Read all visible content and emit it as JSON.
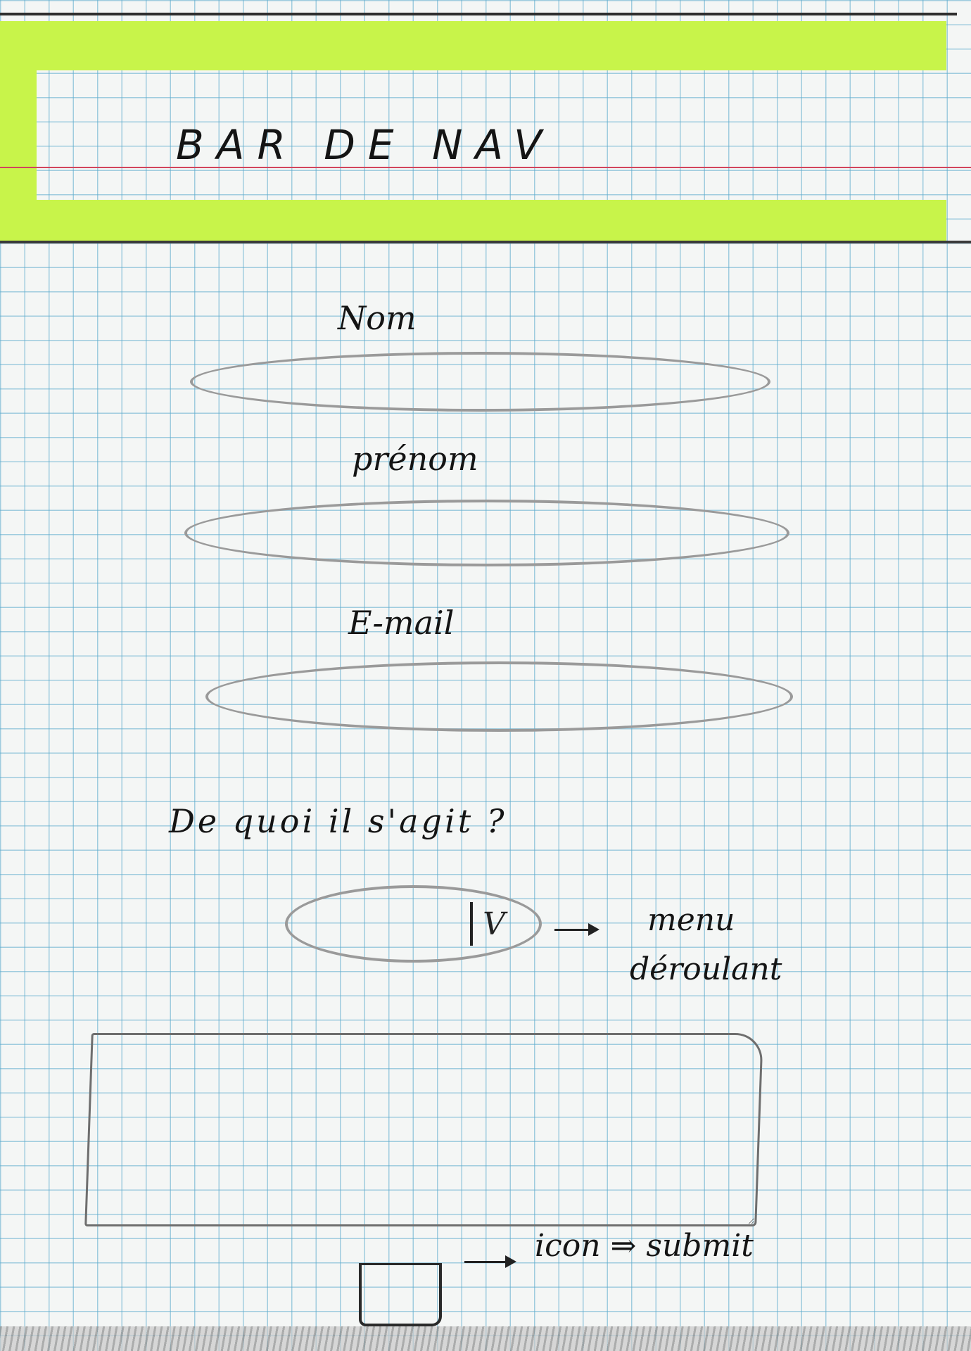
{
  "navbar": {
    "title": "BAR DE NAV"
  },
  "form": {
    "fields": [
      {
        "label": "Nom"
      },
      {
        "label": "prénom"
      },
      {
        "label": "E-mail"
      }
    ],
    "question": {
      "label": "De quoi il s'agit ?",
      "chevron": "V"
    },
    "select_annotation": {
      "line1": "menu",
      "line2": "déroulant"
    },
    "submit_annotation": "icon ⇒ submit"
  },
  "colors": {
    "highlighter": "#c8f44a",
    "grid": "#5aaacd",
    "ink": "#141414",
    "pencil": "#9a9a9a"
  }
}
